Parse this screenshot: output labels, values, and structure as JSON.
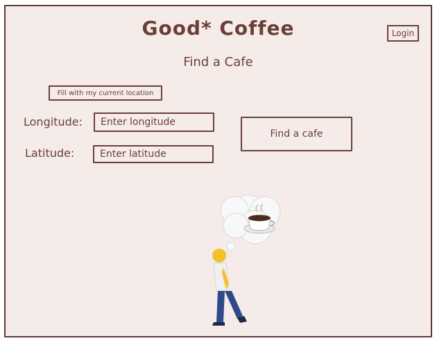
{
  "header": {
    "title": "Good* Coffee",
    "login_label": "Login"
  },
  "main": {
    "subtitle": "Find a Cafe",
    "fill_location_label": "Fill with my current location",
    "longitude_label": "Longitude:",
    "latitude_label": "Latitude:",
    "longitude_placeholder": "Enter longitude",
    "latitude_placeholder": "Enter latitude",
    "find_button_label": "Find a cafe"
  },
  "illustration": {
    "icons": [
      "thought-cloud-icon",
      "coffee-cup-icon",
      "walking-person-icon"
    ]
  },
  "colors": {
    "background": "#f5ece9",
    "ink": "#6a3f38"
  }
}
